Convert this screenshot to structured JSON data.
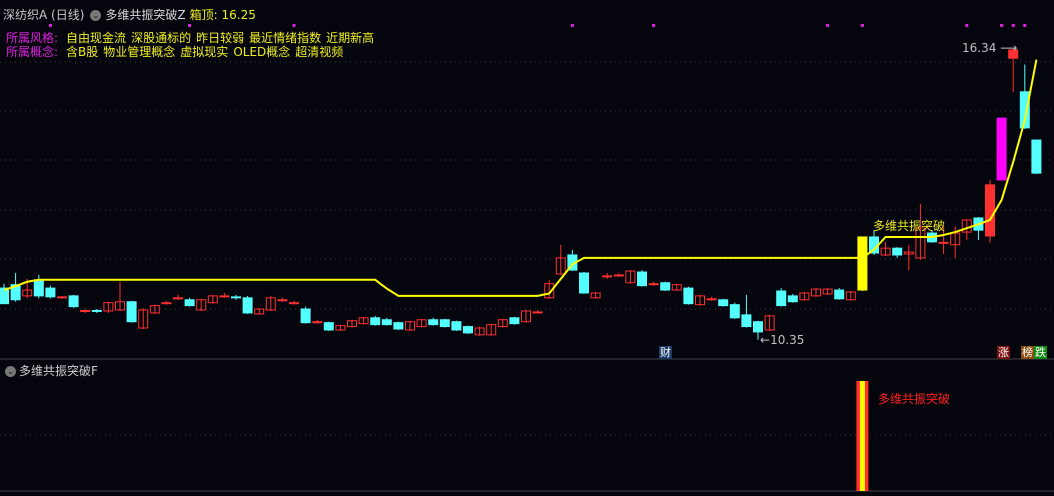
{
  "header": {
    "stock": "深纺织A (日线)",
    "indicator": "多维共振突破Z",
    "box_top_label": "箱顶: 16.25"
  },
  "style_row": {
    "label": "所属风格:",
    "items": [
      "自由现金流",
      "深股通标的",
      "昨日较弱",
      "最近情绪指数",
      "近期新高"
    ]
  },
  "concept_row": {
    "label": "所属概念:",
    "items": [
      "含B股",
      "物业管理概念",
      "虚拟现实",
      "OLED概念",
      "超清视频"
    ]
  },
  "annotations": {
    "high": "16.34",
    "low": "10.35",
    "signal": "多维共振突破"
  },
  "badges": {
    "finance": "财",
    "rise": "涨",
    "list": "榜",
    "fall": "跌"
  },
  "sub_pane": {
    "title": "多维共振突破F",
    "signal_label": "多维共振突破"
  },
  "colors": {
    "up": "#ff3030",
    "down": "#54ffff",
    "line": "#ffff00",
    "marker": "#e020e0",
    "signal_magenta": "#ff00ff",
    "signal_yellow": "#ffff00"
  },
  "chart_data": {
    "type": "candlestick",
    "price_high": 16.34,
    "price_low": 10.35,
    "candles_ohlc": [
      [
        11.41,
        11.5,
        11.09,
        11.09
      ],
      [
        11.48,
        11.72,
        11.13,
        11.17
      ],
      [
        11.25,
        11.6,
        11.2,
        11.37
      ],
      [
        11.58,
        11.68,
        11.2,
        11.25
      ],
      [
        11.41,
        11.46,
        11.2,
        11.23
      ],
      [
        11.21,
        11.25,
        11.19,
        11.23
      ],
      [
        11.25,
        11.27,
        11.0,
        11.03
      ],
      [
        10.94,
        10.98,
        10.9,
        10.95
      ],
      [
        10.95,
        10.98,
        10.9,
        10.94
      ],
      [
        10.94,
        11.13,
        10.9,
        11.11
      ],
      [
        10.96,
        11.54,
        10.94,
        11.13
      ],
      [
        11.13,
        11.15,
        10.7,
        10.72
      ],
      [
        10.59,
        11.0,
        10.57,
        10.96
      ],
      [
        10.9,
        11.07,
        10.88,
        11.05
      ],
      [
        11.11,
        11.15,
        11.07,
        11.11
      ],
      [
        11.21,
        11.27,
        11.17,
        11.21
      ],
      [
        11.17,
        11.21,
        11.03,
        11.05
      ],
      [
        10.96,
        11.19,
        10.94,
        11.17
      ],
      [
        11.11,
        11.27,
        11.09,
        11.25
      ],
      [
        11.25,
        11.31,
        11.21,
        11.25
      ],
      [
        11.23,
        11.27,
        11.17,
        11.21
      ],
      [
        11.21,
        11.25,
        10.88,
        10.9
      ],
      [
        10.88,
        11.0,
        10.86,
        10.98
      ],
      [
        10.96,
        11.25,
        10.94,
        11.21
      ],
      [
        11.17,
        11.21,
        11.13,
        11.17
      ],
      [
        11.11,
        11.15,
        11.07,
        11.11
      ],
      [
        10.98,
        11.03,
        10.68,
        10.7
      ],
      [
        10.72,
        10.76,
        10.68,
        10.72
      ],
      [
        10.7,
        10.72,
        10.53,
        10.55
      ],
      [
        10.55,
        10.66,
        10.53,
        10.64
      ],
      [
        10.62,
        10.76,
        10.6,
        10.74
      ],
      [
        10.68,
        10.82,
        10.66,
        10.8
      ],
      [
        10.8,
        10.84,
        10.64,
        10.66
      ],
      [
        10.76,
        10.8,
        10.64,
        10.66
      ],
      [
        10.7,
        10.72,
        10.55,
        10.57
      ],
      [
        10.55,
        10.74,
        10.53,
        10.72
      ],
      [
        10.62,
        10.78,
        10.6,
        10.76
      ],
      [
        10.76,
        10.8,
        10.64,
        10.66
      ],
      [
        10.76,
        10.78,
        10.6,
        10.62
      ],
      [
        10.72,
        10.74,
        10.53,
        10.55
      ],
      [
        10.62,
        10.64,
        10.47,
        10.49
      ],
      [
        10.45,
        10.62,
        10.43,
        10.59
      ],
      [
        10.45,
        10.68,
        10.43,
        10.66
      ],
      [
        10.62,
        10.78,
        10.6,
        10.76
      ],
      [
        10.8,
        10.82,
        10.66,
        10.68
      ],
      [
        10.72,
        10.96,
        10.7,
        10.94
      ],
      [
        10.92,
        10.96,
        10.9,
        10.92
      ],
      [
        11.21,
        11.58,
        11.19,
        11.5
      ],
      [
        11.7,
        12.3,
        11.68,
        12.03
      ],
      [
        12.09,
        12.19,
        11.76,
        11.78
      ],
      [
        11.72,
        11.74,
        11.29,
        11.31
      ],
      [
        11.21,
        11.33,
        11.19,
        11.31
      ],
      [
        11.66,
        11.72,
        11.6,
        11.66
      ],
      [
        11.68,
        11.72,
        11.64,
        11.68
      ],
      [
        11.52,
        11.78,
        11.5,
        11.76
      ],
      [
        11.74,
        11.78,
        11.44,
        11.46
      ],
      [
        11.5,
        11.54,
        11.46,
        11.5
      ],
      [
        11.52,
        11.54,
        11.35,
        11.37
      ],
      [
        11.37,
        11.5,
        11.35,
        11.48
      ],
      [
        11.41,
        11.44,
        11.07,
        11.09
      ],
      [
        11.07,
        11.27,
        11.05,
        11.25
      ],
      [
        11.19,
        11.23,
        11.15,
        11.19
      ],
      [
        11.17,
        11.19,
        11.03,
        11.05
      ],
      [
        11.07,
        11.11,
        10.78,
        10.8
      ],
      [
        10.86,
        11.27,
        10.6,
        10.62
      ],
      [
        10.72,
        10.74,
        10.35,
        10.51
      ],
      [
        10.55,
        10.86,
        10.53,
        10.84
      ],
      [
        11.35,
        11.41,
        11.03,
        11.05
      ],
      [
        11.25,
        11.29,
        11.11,
        11.13
      ],
      [
        11.17,
        11.33,
        11.15,
        11.31
      ],
      [
        11.25,
        11.41,
        11.23,
        11.39
      ],
      [
        11.29,
        11.41,
        11.27,
        11.39
      ],
      [
        11.37,
        11.41,
        11.17,
        11.19
      ],
      [
        11.17,
        11.35,
        11.15,
        11.33
      ],
      [
        11.37,
        12.46,
        11.35,
        12.46
      ],
      [
        12.46,
        12.6,
        12.09,
        12.13
      ],
      [
        12.09,
        12.36,
        12.07,
        12.23
      ],
      [
        12.23,
        12.25,
        12.03,
        12.09
      ],
      [
        12.11,
        12.3,
        11.78,
        12.15
      ],
      [
        12.03,
        13.14,
        11.99,
        12.64
      ],
      [
        12.54,
        12.6,
        12.34,
        12.36
      ],
      [
        12.33,
        12.68,
        12.11,
        12.35
      ],
      [
        12.3,
        12.68,
        12.03,
        12.54
      ],
      [
        12.56,
        12.81,
        12.4,
        12.81
      ],
      [
        12.85,
        12.87,
        12.4,
        12.6
      ],
      [
        12.48,
        13.63,
        12.34,
        13.53
      ],
      [
        13.63,
        14.9,
        13.63,
        14.9
      ],
      [
        16.13,
        16.34,
        15.44,
        16.3
      ],
      [
        15.44,
        16.0,
        14.68,
        14.7
      ],
      [
        14.45,
        14.45,
        13.75,
        13.77
      ]
    ],
    "special_candles": {
      "74": "yellow",
      "85": "red",
      "86": "magenta",
      "87": "red"
    },
    "line_values": [
      11.37,
      11.45,
      11.54,
      11.58,
      11.58,
      11.58,
      11.58,
      11.58,
      11.58,
      11.58,
      11.58,
      11.58,
      11.58,
      11.58,
      11.58,
      11.58,
      11.58,
      11.58,
      11.58,
      11.58,
      11.58,
      11.58,
      11.58,
      11.58,
      11.58,
      11.58,
      11.58,
      11.58,
      11.58,
      11.58,
      11.58,
      11.58,
      11.58,
      11.4,
      11.25,
      11.25,
      11.25,
      11.25,
      11.25,
      11.25,
      11.25,
      11.25,
      11.25,
      11.25,
      11.25,
      11.25,
      11.25,
      11.3,
      11.6,
      11.9,
      12.03,
      12.03,
      12.03,
      12.03,
      12.03,
      12.03,
      12.03,
      12.03,
      12.03,
      12.03,
      12.03,
      12.03,
      12.03,
      12.03,
      12.03,
      12.03,
      12.03,
      12.03,
      12.03,
      12.03,
      12.03,
      12.03,
      12.03,
      12.03,
      12.03,
      12.2,
      12.46,
      12.46,
      12.46,
      12.46,
      12.46,
      12.5,
      12.56,
      12.64,
      12.72,
      12.81,
      13.22,
      14.0,
      14.86,
      16.1
    ],
    "marker_indices": [
      4,
      16,
      25,
      49,
      56,
      71,
      74,
      83,
      86,
      87,
      88
    ],
    "signal_index": 74
  }
}
